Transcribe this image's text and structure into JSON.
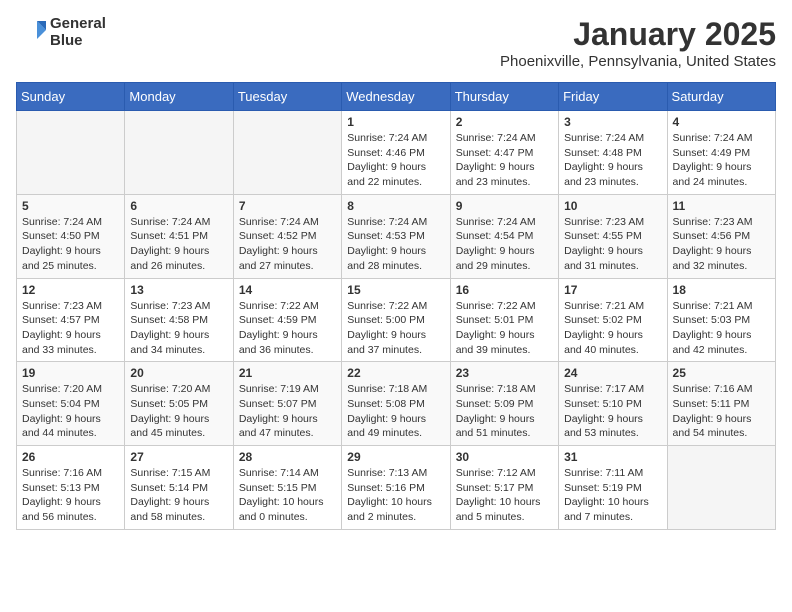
{
  "logo": {
    "text1": "General",
    "text2": "Blue"
  },
  "title": "January 2025",
  "location": "Phoenixville, Pennsylvania, United States",
  "weekdays": [
    "Sunday",
    "Monday",
    "Tuesday",
    "Wednesday",
    "Thursday",
    "Friday",
    "Saturday"
  ],
  "weeks": [
    [
      {
        "day": "",
        "info": ""
      },
      {
        "day": "",
        "info": ""
      },
      {
        "day": "",
        "info": ""
      },
      {
        "day": "1",
        "info": "Sunrise: 7:24 AM\nSunset: 4:46 PM\nDaylight: 9 hours\nand 22 minutes."
      },
      {
        "day": "2",
        "info": "Sunrise: 7:24 AM\nSunset: 4:47 PM\nDaylight: 9 hours\nand 23 minutes."
      },
      {
        "day": "3",
        "info": "Sunrise: 7:24 AM\nSunset: 4:48 PM\nDaylight: 9 hours\nand 23 minutes."
      },
      {
        "day": "4",
        "info": "Sunrise: 7:24 AM\nSunset: 4:49 PM\nDaylight: 9 hours\nand 24 minutes."
      }
    ],
    [
      {
        "day": "5",
        "info": "Sunrise: 7:24 AM\nSunset: 4:50 PM\nDaylight: 9 hours\nand 25 minutes."
      },
      {
        "day": "6",
        "info": "Sunrise: 7:24 AM\nSunset: 4:51 PM\nDaylight: 9 hours\nand 26 minutes."
      },
      {
        "day": "7",
        "info": "Sunrise: 7:24 AM\nSunset: 4:52 PM\nDaylight: 9 hours\nand 27 minutes."
      },
      {
        "day": "8",
        "info": "Sunrise: 7:24 AM\nSunset: 4:53 PM\nDaylight: 9 hours\nand 28 minutes."
      },
      {
        "day": "9",
        "info": "Sunrise: 7:24 AM\nSunset: 4:54 PM\nDaylight: 9 hours\nand 29 minutes."
      },
      {
        "day": "10",
        "info": "Sunrise: 7:23 AM\nSunset: 4:55 PM\nDaylight: 9 hours\nand 31 minutes."
      },
      {
        "day": "11",
        "info": "Sunrise: 7:23 AM\nSunset: 4:56 PM\nDaylight: 9 hours\nand 32 minutes."
      }
    ],
    [
      {
        "day": "12",
        "info": "Sunrise: 7:23 AM\nSunset: 4:57 PM\nDaylight: 9 hours\nand 33 minutes."
      },
      {
        "day": "13",
        "info": "Sunrise: 7:23 AM\nSunset: 4:58 PM\nDaylight: 9 hours\nand 34 minutes."
      },
      {
        "day": "14",
        "info": "Sunrise: 7:22 AM\nSunset: 4:59 PM\nDaylight: 9 hours\nand 36 minutes."
      },
      {
        "day": "15",
        "info": "Sunrise: 7:22 AM\nSunset: 5:00 PM\nDaylight: 9 hours\nand 37 minutes."
      },
      {
        "day": "16",
        "info": "Sunrise: 7:22 AM\nSunset: 5:01 PM\nDaylight: 9 hours\nand 39 minutes."
      },
      {
        "day": "17",
        "info": "Sunrise: 7:21 AM\nSunset: 5:02 PM\nDaylight: 9 hours\nand 40 minutes."
      },
      {
        "day": "18",
        "info": "Sunrise: 7:21 AM\nSunset: 5:03 PM\nDaylight: 9 hours\nand 42 minutes."
      }
    ],
    [
      {
        "day": "19",
        "info": "Sunrise: 7:20 AM\nSunset: 5:04 PM\nDaylight: 9 hours\nand 44 minutes."
      },
      {
        "day": "20",
        "info": "Sunrise: 7:20 AM\nSunset: 5:05 PM\nDaylight: 9 hours\nand 45 minutes."
      },
      {
        "day": "21",
        "info": "Sunrise: 7:19 AM\nSunset: 5:07 PM\nDaylight: 9 hours\nand 47 minutes."
      },
      {
        "day": "22",
        "info": "Sunrise: 7:18 AM\nSunset: 5:08 PM\nDaylight: 9 hours\nand 49 minutes."
      },
      {
        "day": "23",
        "info": "Sunrise: 7:18 AM\nSunset: 5:09 PM\nDaylight: 9 hours\nand 51 minutes."
      },
      {
        "day": "24",
        "info": "Sunrise: 7:17 AM\nSunset: 5:10 PM\nDaylight: 9 hours\nand 53 minutes."
      },
      {
        "day": "25",
        "info": "Sunrise: 7:16 AM\nSunset: 5:11 PM\nDaylight: 9 hours\nand 54 minutes."
      }
    ],
    [
      {
        "day": "26",
        "info": "Sunrise: 7:16 AM\nSunset: 5:13 PM\nDaylight: 9 hours\nand 56 minutes."
      },
      {
        "day": "27",
        "info": "Sunrise: 7:15 AM\nSunset: 5:14 PM\nDaylight: 9 hours\nand 58 minutes."
      },
      {
        "day": "28",
        "info": "Sunrise: 7:14 AM\nSunset: 5:15 PM\nDaylight: 10 hours\nand 0 minutes."
      },
      {
        "day": "29",
        "info": "Sunrise: 7:13 AM\nSunset: 5:16 PM\nDaylight: 10 hours\nand 2 minutes."
      },
      {
        "day": "30",
        "info": "Sunrise: 7:12 AM\nSunset: 5:17 PM\nDaylight: 10 hours\nand 5 minutes."
      },
      {
        "day": "31",
        "info": "Sunrise: 7:11 AM\nSunset: 5:19 PM\nDaylight: 10 hours\nand 7 minutes."
      },
      {
        "day": "",
        "info": ""
      }
    ]
  ]
}
